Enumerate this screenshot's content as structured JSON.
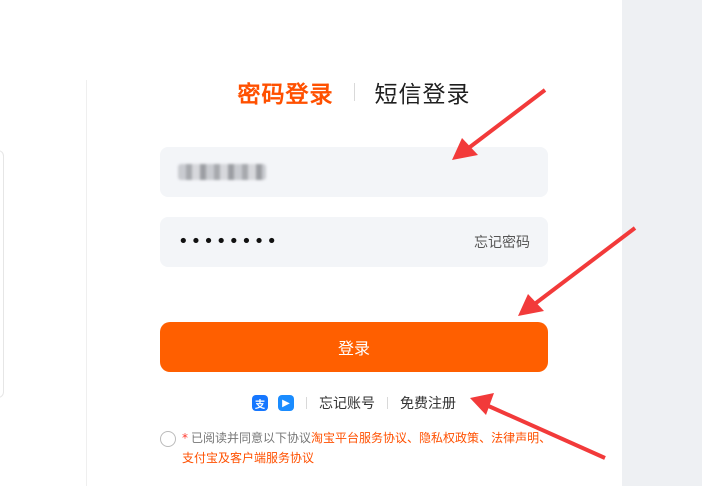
{
  "tabs": {
    "password_login": "密码登录",
    "sms_login": "短信登录"
  },
  "username": {
    "value": ""
  },
  "password": {
    "masked": "••••••••",
    "forgot_password": "忘记密码"
  },
  "login_button": "登录",
  "links": {
    "forgot_account": "忘记账号",
    "register": "免费注册",
    "alipay_icon_text": "支",
    "app_icon_text": "▶"
  },
  "agreement": {
    "star": "*",
    "prefix": "已阅读并同意以下协议",
    "link1": "淘宝平台服务协议",
    "sep1": "、",
    "link2": "隐私权政策",
    "sep2": "、",
    "link3": "法律声明",
    "sep3": "、",
    "link4": "支付宝及客户端服务协议"
  },
  "colors": {
    "accent": "#ff5000",
    "button": "#ff5f00",
    "field_bg": "#f3f5f8",
    "arrow": "#f23a3a"
  }
}
